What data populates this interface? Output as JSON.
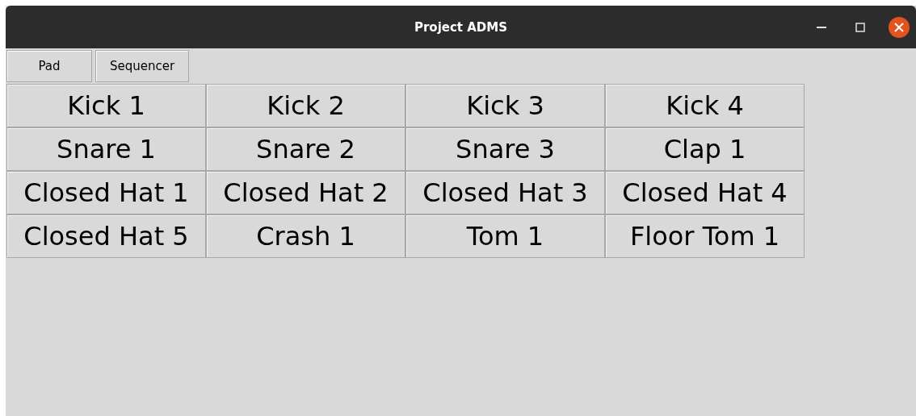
{
  "window": {
    "title": "Project ADMS"
  },
  "tabs": [
    {
      "label": "Pad"
    },
    {
      "label": "Sequencer"
    }
  ],
  "pads": [
    [
      "Kick 1",
      "Kick 2",
      "Kick 3",
      "Kick 4"
    ],
    [
      "Snare 1",
      "Snare 2",
      "Snare 3",
      "Clap 1"
    ],
    [
      "Closed Hat 1",
      "Closed Hat 2",
      "Closed Hat 3",
      "Closed Hat 4"
    ],
    [
      "Closed Hat 5",
      "Crash 1",
      "Tom 1",
      "Floor Tom 1"
    ]
  ]
}
